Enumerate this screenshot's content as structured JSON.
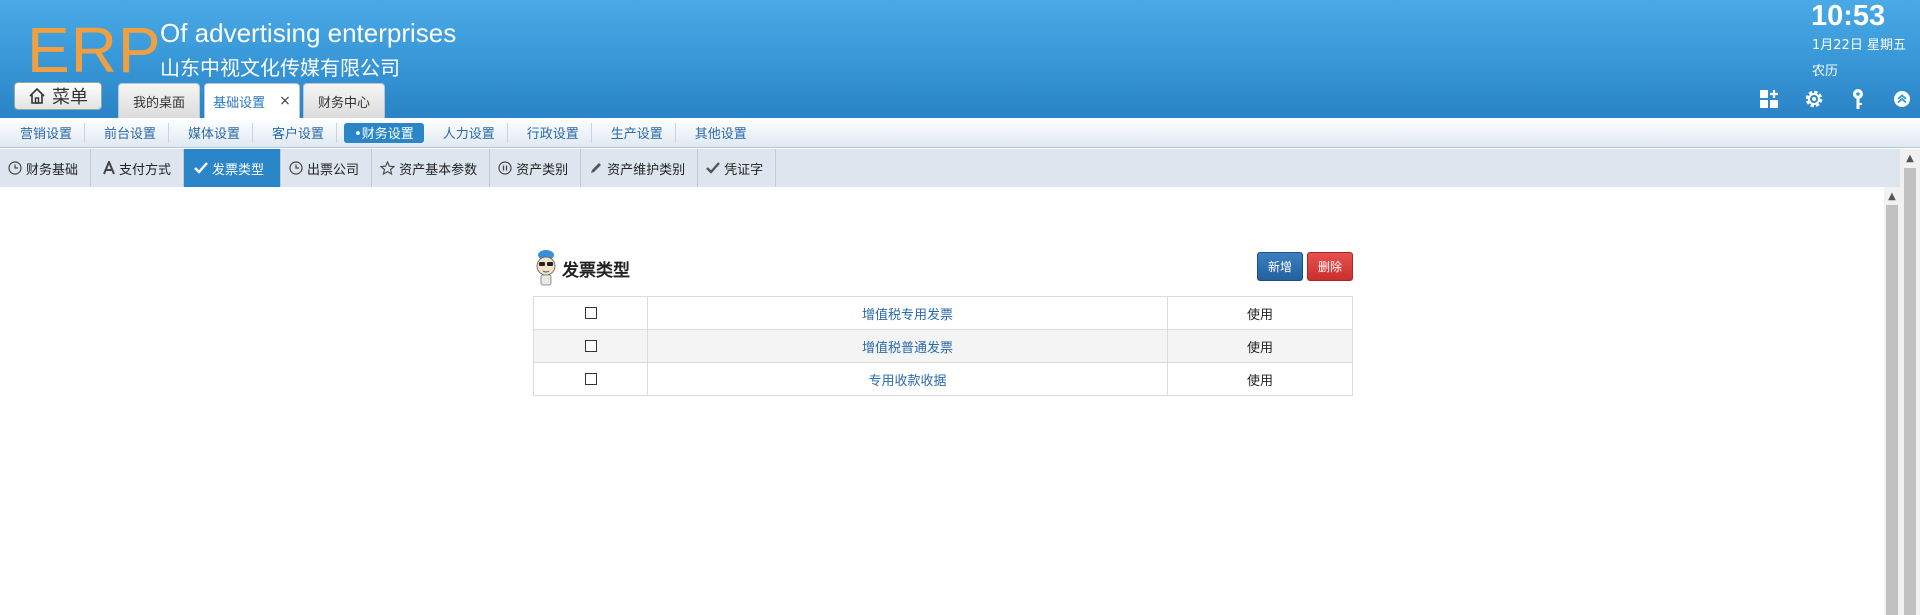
{
  "header": {
    "logo": "ERP",
    "title_en": "Of advertising enterprises",
    "title_cn": "山东中视文化传媒有限公司",
    "time": "10:53",
    "date": "1月22日 星期五",
    "lunar": "农历",
    "menu_label": "菜单"
  },
  "top_tabs": [
    {
      "label": "我的桌面"
    },
    {
      "label": "基础设置",
      "close": "×"
    },
    {
      "label": "财务中心"
    }
  ],
  "header_icons": [
    "grid-add-icon",
    "gear-icon",
    "key-icon",
    "chevron-up-circle-icon"
  ],
  "nav": {
    "items": [
      {
        "label": "营销设置"
      },
      {
        "label": "前台设置"
      },
      {
        "label": "媒体设置"
      },
      {
        "label": "客户设置"
      },
      {
        "label": "•财务设置"
      },
      {
        "label": "人力设置"
      },
      {
        "label": "行政设置"
      },
      {
        "label": "生产设置"
      },
      {
        "label": "其他设置"
      }
    ],
    "active_index": 4
  },
  "subtabs": {
    "items": [
      {
        "label": "财务基础",
        "icon": "clock-icon"
      },
      {
        "label": "支付方式",
        "icon": "font-a-icon"
      },
      {
        "label": "发票类型",
        "icon": "check-icon"
      },
      {
        "label": "出票公司",
        "icon": "clock-icon"
      },
      {
        "label": "资产基本参数",
        "icon": "star-icon"
      },
      {
        "label": "资产类别",
        "icon": "pause-circle-icon"
      },
      {
        "label": "资产维护类别",
        "icon": "pencil-icon"
      },
      {
        "label": "凭证字",
        "icon": "check-icon"
      }
    ],
    "active_index": 2
  },
  "panel": {
    "title": "发票类型",
    "add_label": "新增",
    "delete_label": "删除",
    "rows": [
      {
        "name": "增值税专用发票",
        "status": "使用"
      },
      {
        "name": "增值税普通发票",
        "status": "使用"
      },
      {
        "name": "专用收款收据",
        "status": "使用"
      }
    ]
  },
  "colors": {
    "header_blue": "#3796d6",
    "logo_orange": "#f0a040",
    "active_blue": "#2a86c8",
    "link_blue": "#2a6aa8",
    "add_button": "#2a6aa8",
    "delete_button": "#d9403c"
  }
}
